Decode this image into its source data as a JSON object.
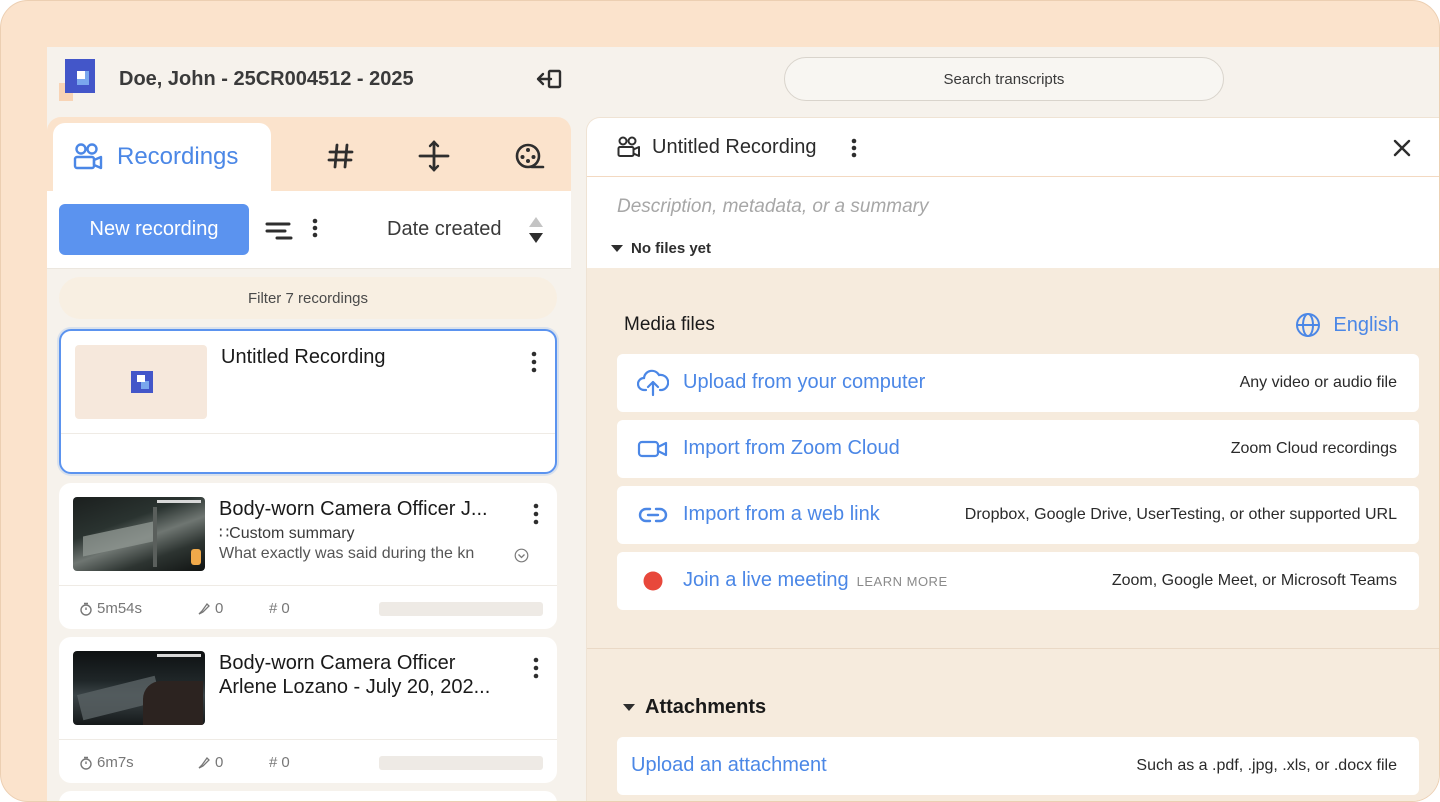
{
  "header": {
    "case_title": "Doe, John - 25CR004512 - 2025",
    "search_placeholder": "Search transcripts"
  },
  "tabs": [
    {
      "label": "Recordings",
      "icon": "recordings-icon",
      "active": true
    },
    {
      "label": "",
      "icon": "hash-icon"
    },
    {
      "label": "",
      "icon": "crosshair-icon"
    },
    {
      "label": "",
      "icon": "film-reel-icon"
    }
  ],
  "toolbar": {
    "new_recording": "New recording",
    "sort_label": "Date created"
  },
  "filter": {
    "placeholder": "Filter 7 recordings"
  },
  "recordings": [
    {
      "title": "Untitled Recording",
      "selected": true
    },
    {
      "title": "Body-worn Camera Officer J...",
      "summary_label": "∷Custom summary",
      "summary_text": "What exactly was said during the kn",
      "duration": "5m54s",
      "highlights": "0",
      "tags": "0"
    },
    {
      "title_line1": "Body-worn Camera Officer",
      "title_line2": "Arlene Lozano - July 20, 202...",
      "duration": "6m7s",
      "highlights": "0",
      "tags": "0"
    }
  ],
  "detail": {
    "title": "Untitled Recording",
    "description_placeholder": "Description, metadata, or a summary",
    "files_toggle": "No files yet",
    "media_title": "Media files",
    "language": "English",
    "options": [
      {
        "label": "Upload from your computer",
        "hint": "Any video or audio file",
        "icon": "cloud-upload-icon"
      },
      {
        "label": "Import from Zoom Cloud",
        "hint": "Zoom Cloud recordings",
        "icon": "video-camera-icon"
      },
      {
        "label": "Import from a web link",
        "hint": "Dropbox, Google Drive, UserTesting, or other supported URL",
        "icon": "link-icon"
      },
      {
        "label": "Join a live meeting",
        "learn_more": "LEARN MORE",
        "hint": "Zoom, Google Meet, or Microsoft Teams",
        "icon": "record-dot-icon"
      }
    ],
    "attachments_title": "Attachments",
    "attachment_option": {
      "label": "Upload an attachment",
      "hint": "Such as a .pdf, .jpg, .xls, or .docx file"
    }
  },
  "colors": {
    "accent": "#4b87e6",
    "button": "#5b93ef",
    "frame": "#fbe3cc",
    "record_dot": "#e8483b"
  }
}
